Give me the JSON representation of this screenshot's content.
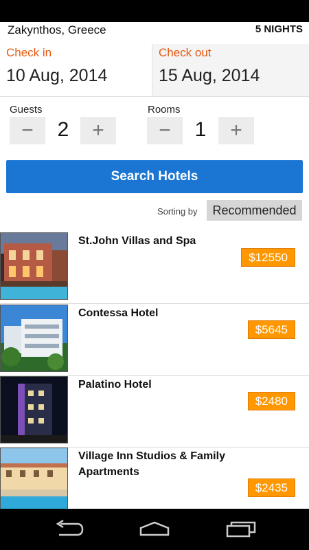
{
  "header": {
    "location": "Zakynthos, Greece",
    "nights": "5 NIGHTS"
  },
  "dates": {
    "checkin_label": "Check in",
    "checkin_value": "10 Aug, 2014",
    "checkout_label": "Check out",
    "checkout_value": "15 Aug, 2014"
  },
  "guests": {
    "label": "Guests",
    "value": "2",
    "minus": "−",
    "plus": "+"
  },
  "rooms": {
    "label": "Rooms",
    "value": "1",
    "minus": "−",
    "plus": "+"
  },
  "search": {
    "button_label": "Search Hotels"
  },
  "sorting": {
    "label": "Sorting by",
    "value": "Recommended"
  },
  "hotels": [
    {
      "name": "St.John Villas and Spa",
      "price": "$12550"
    },
    {
      "name": "Contessa Hotel",
      "price": "$5645"
    },
    {
      "name": "Palatino Hotel",
      "price": "$2480"
    },
    {
      "name": "Village Inn Studios & Family Apartments",
      "price": "$2435"
    }
  ],
  "colors": {
    "accent": "#1a76d2",
    "price": "#ff9800",
    "date_label": "#e55a12"
  },
  "nav": {
    "back": "back-icon",
    "home": "home-icon",
    "recents": "recents-icon"
  }
}
